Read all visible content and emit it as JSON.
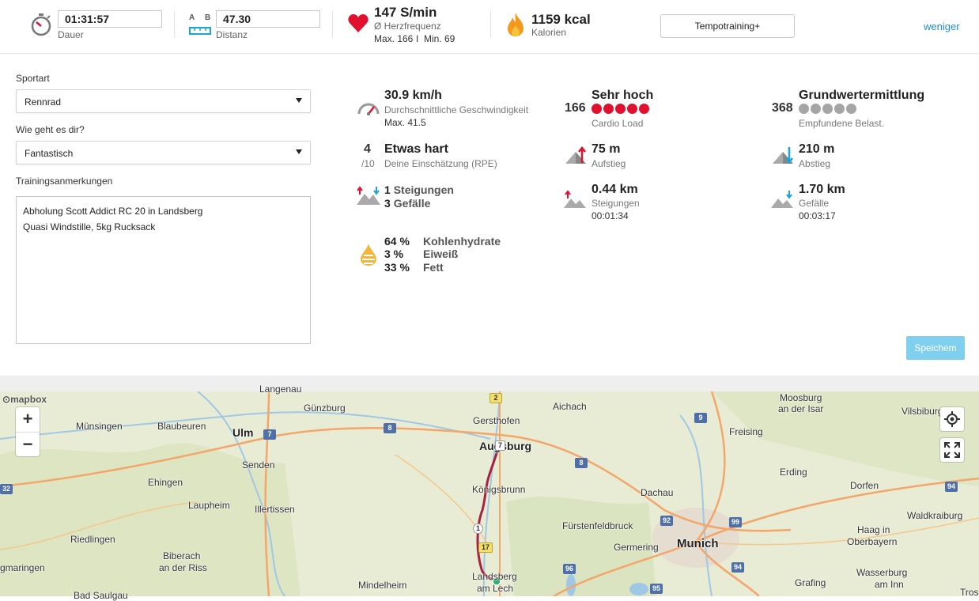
{
  "top": {
    "duration": {
      "value": "01:31:57",
      "label": "Dauer"
    },
    "distance": {
      "a": "A",
      "b": "B",
      "value": "47.30",
      "label": "Distanz"
    },
    "heart": {
      "value": "147 S/min",
      "label": "Ø Herzfrequenz",
      "max": "Max. 166",
      "sep": "I",
      "min": "Min. 69"
    },
    "calories": {
      "value": "1159 kcal",
      "label": "Kalorien"
    },
    "program_button": "Tempotraining+",
    "less_link": "weniger"
  },
  "form": {
    "sport_label": "Sportart",
    "sport_value": "Rennrad",
    "mood_label": "Wie geht es dir?",
    "mood_value": "Fantastisch",
    "notes_label": "Trainingsanmerkungen",
    "notes_lines": [
      "Abholung Scott Addict RC 20 in Landsberg",
      "Quasi Windstille, 5kg Rucksack"
    ]
  },
  "stats": {
    "speed": {
      "title": "30.9 km/h",
      "sub": "Durchschnittliche Geschwindigkeit",
      "max": "Max. 41.5"
    },
    "rpe": {
      "num": "4",
      "den": "/10",
      "title": "Etwas hart",
      "sub": "Deine Einschätzung (RPE)"
    },
    "slopes": {
      "up_n": "1",
      "up_label": "Steigungen",
      "down_n": "3",
      "down_label": "Gefälle"
    },
    "nutrition": [
      {
        "pct": "64 %",
        "label": "Kohlenhydrate"
      },
      {
        "pct": "3 %",
        "label": "Eiweiß"
      },
      {
        "pct": "33 %",
        "label": "Fett"
      }
    ],
    "cardio": {
      "num": "166",
      "title": "Sehr hoch",
      "sub": "Cardio Load",
      "dots_filled": 5,
      "dots_total": 5,
      "color": "#e0102e"
    },
    "ascent": {
      "title": "75 m",
      "sub": "Aufstieg"
    },
    "climbs": {
      "title": "0.44 km",
      "sub": "Steigungen",
      "time": "00:01:34"
    },
    "basis": {
      "num": "368",
      "title": "Grundwertermittlung",
      "sub": "Empfundene Belast.",
      "dots_filled": 0,
      "dots_total": 5,
      "color": "#a5a5a5"
    },
    "descent": {
      "title": "210 m",
      "sub": "Abstieg"
    },
    "declines": {
      "title": "1.70 km",
      "sub": "Gefälle",
      "time": "00:03:17"
    }
  },
  "save_button": "Speichem",
  "map": {
    "attribution": "mapbox",
    "zoom_in": "+",
    "zoom_out": "−",
    "cities": {
      "c1": "Langenau",
      "c2": "Günzburg",
      "c3": "Gersthofen",
      "c4": "Aichach",
      "c5": "Moosburg",
      "c5b": "an der Isar",
      "c6": "Vilsbiburg",
      "c7": "Münsingen",
      "c8": "Blaubeuren",
      "c9": "Ulm",
      "c10": "Augsburg",
      "c11": "Freising",
      "c12": "Senden",
      "c13": "Ehingen",
      "c14": "Königsbrunn",
      "c15": "Dachau",
      "c16": "Erding",
      "c17": "Dorfen",
      "c18": "Laupheim",
      "c19": "Illertissen",
      "c20": "Fürstenfeldbruck",
      "c21": "Waldkraiburg",
      "c22": "Riedlingen",
      "c23": "Haag in",
      "c23b": "Oberbayern",
      "c24": "Biberach",
      "c24b": "an der Riss",
      "c25": "Germering",
      "c26": "Munich",
      "c27": "Wasserburg",
      "c27b": "am Inn",
      "c28": "gmaringen",
      "c29": "Landsberg",
      "c29b": "am Lech",
      "c30": "Mindelheim",
      "c31": "Grafing",
      "c32": "Bad Saulgau",
      "c33": "Tros"
    },
    "shields": {
      "s2": "2",
      "s7a": "7",
      "s8": "8",
      "s9": "9",
      "s7b": "7",
      "s1": "1",
      "s17": "17",
      "s92": "92",
      "s99": "99",
      "s94": "94",
      "s96": "96",
      "s95": "95",
      "s32": "32",
      "s94b": "94"
    }
  }
}
